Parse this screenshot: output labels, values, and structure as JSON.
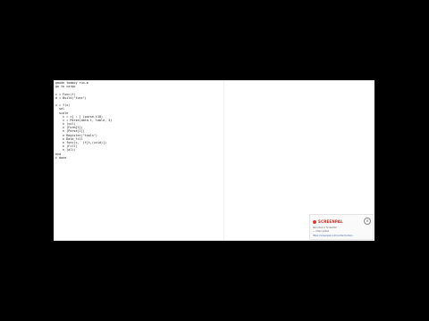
{
  "editor": {
    "lines": [
      "gmode tomboy run.m",
      "go to cargo",
      "",
      "c = Func(f)",
      "d = Build(\"func\")",
      "",
      "x = f(x)",
      "  sel",
      "  scale",
      "    c = c[ : ] (parse.t10)",
      "    c = Parse(data.t, table, 3)",
      "    n (col)",
      "    n (Form[1])",
      "    n (Parse[1])",
      "    n Register(\"tools\")",
      "    n Data_fill",
      "    n func(c,  (f[t,(ccid)])",
      "    n (Fill)",
      "    n (all)",
      "end",
      "c done"
    ]
  },
  "toast": {
    "brand": "SCREENPAL",
    "close_glyph": "×",
    "line1": "Recorded in ScreenPal",
    "line2": "— Video added",
    "line3": "https://screenpal.com/content/video/..."
  }
}
